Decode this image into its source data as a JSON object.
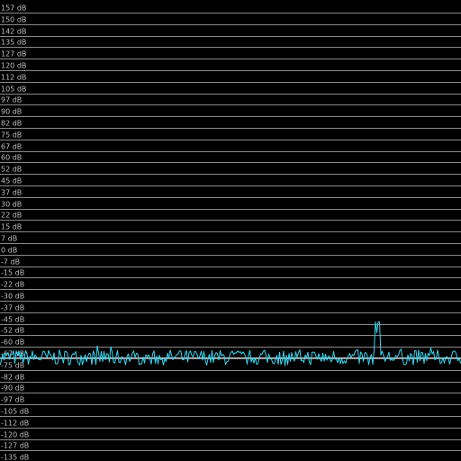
{
  "spectrum_view": {
    "background_color": "#000000",
    "grid_color": "#8a8a8a",
    "label_color": "#bdbdbd",
    "trace_color": "#35d8f2",
    "baseline_color": "#c9c9c9",
    "y_axis": {
      "unit": "dB",
      "labels": [
        "157 dB",
        "150 dB",
        "142 dB",
        "135 dB",
        "127 dB",
        "120 dB",
        "112 dB",
        "105 dB",
        "97 dB",
        "90 dB",
        "82 dB",
        "75 dB",
        "67 dB",
        "60 dB",
        "52 dB",
        "45 dB",
        "37 dB",
        "30 dB",
        "22 dB",
        "15 dB",
        "7 dB",
        "0 dB",
        "-7 dB",
        "-15 dB",
        "-22 dB",
        "-30 dB",
        "-37 dB",
        "-45 dB",
        "-52 dB",
        "-60 dB",
        "-67 dB",
        "-75 dB",
        "-82 dB",
        "-90 dB",
        "-97 dB",
        "-105 dB",
        "-112 dB",
        "-120 dB",
        "-127 dB",
        "-135 dB"
      ],
      "top_db": 157,
      "bottom_db": -135
    },
    "trace": {
      "noise_floor_db": -67,
      "noise_peak_to_peak_db": 10,
      "peak": {
        "position_fraction": 0.818,
        "level_db": -51
      }
    },
    "baseline_db": -67
  }
}
